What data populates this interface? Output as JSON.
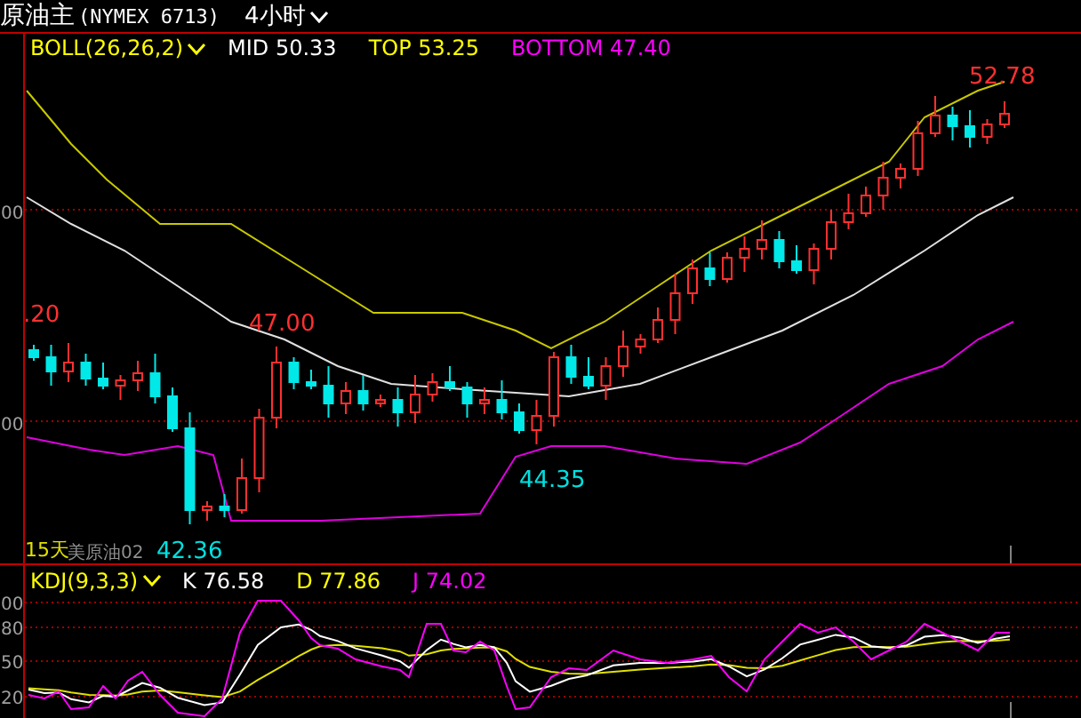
{
  "header": {
    "title": "原油主",
    "code": "(NYMEX 6713)",
    "period": "4小时"
  },
  "main_panel": {
    "indicator": {
      "name": "BOLL(26,26,2)",
      "values": [
        {
          "label": "MID 50.33",
          "color": "#ffffff"
        },
        {
          "label": "TOP 53.25",
          "color": "#ffff00"
        },
        {
          "label": "BOTTOM 47.40",
          "color": "#ff00ff"
        }
      ]
    },
    "axis_labels": [
      "00",
      "00"
    ],
    "price_labels": [
      {
        "text": "52.78",
        "kind": "high"
      },
      {
        "text": ".20",
        "kind": "high"
      },
      {
        "text": "47.00",
        "kind": "high"
      },
      {
        "text": "44.35",
        "kind": "low"
      },
      {
        "text": "42.36",
        "kind": "low"
      }
    ],
    "period_label": "15天",
    "contract_label": "美原油02"
  },
  "kdj_panel": {
    "indicator": {
      "name": "KDJ(9,3,3)",
      "values": [
        {
          "label": "K 76.58",
          "color": "#ffffff"
        },
        {
          "label": "D 77.86",
          "color": "#ffff00"
        },
        {
          "label": "J 74.02",
          "color": "#ff00ff"
        }
      ]
    },
    "axis_labels": [
      "00",
      "80",
      "50",
      "20"
    ]
  }
}
